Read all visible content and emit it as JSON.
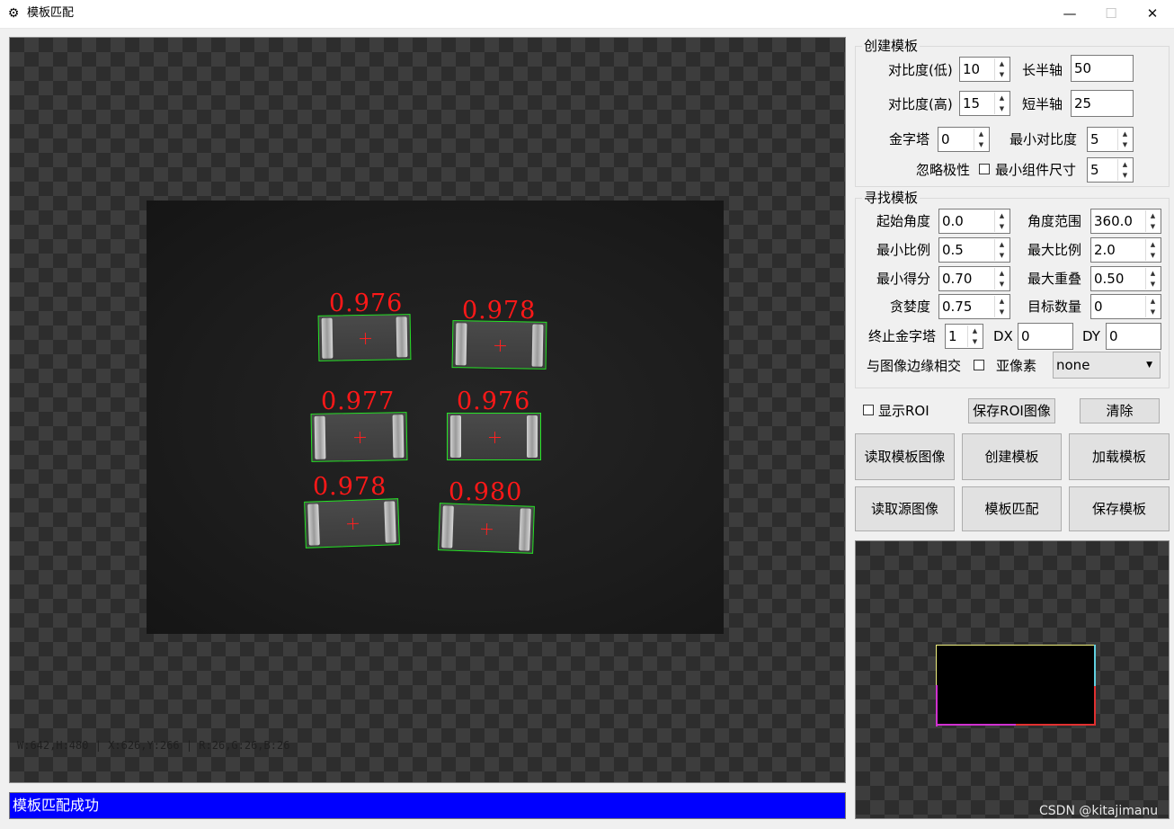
{
  "window": {
    "title": "模板匹配",
    "icon": "gear-icon",
    "minimize": "—",
    "maximize": "☐",
    "close": "✕"
  },
  "main_view": {
    "pixel_info": "W:642,H:480 | X:626,Y:266 | R:26,G:26,B:26",
    "scores": [
      "0.976",
      "0.978",
      "0.977",
      "0.976",
      "0.978",
      "0.980"
    ]
  },
  "status": "模板匹配成功",
  "create_template": {
    "title": "创建模板",
    "contrast_low_label": "对比度(低)",
    "contrast_low": "10",
    "contrast_high_label": "对比度(高)",
    "contrast_high": "15",
    "major_axis_label": "长半轴",
    "major_axis": "50",
    "minor_axis_label": "短半轴",
    "minor_axis": "25",
    "pyramid_label": "金字塔",
    "pyramid": "0",
    "min_contrast_label": "最小对比度",
    "min_contrast": "5",
    "ignore_polarity_label": "忽略极性",
    "min_component_label": "最小组件尺寸",
    "min_component": "5"
  },
  "find_template": {
    "title": "寻找模板",
    "start_angle_label": "起始角度",
    "start_angle": "0.0",
    "angle_range_label": "角度范围",
    "angle_range": "360.0",
    "min_scale_label": "最小比例",
    "min_scale": "0.5",
    "max_scale_label": "最大比例",
    "max_scale": "2.0",
    "min_score_label": "最小得分",
    "min_score": "0.70",
    "max_overlap_label": "最大重叠",
    "max_overlap": "0.50",
    "greediness_label": "贪婪度",
    "greediness": "0.75",
    "num_targets_label": "目标数量",
    "num_targets": "0",
    "stop_pyramid_label": "终止金字塔",
    "stop_pyramid": "1",
    "dx_label": "DX",
    "dx": "0",
    "dy_label": "DY",
    "dy": "0",
    "border_intersect_label": "与图像边缘相交",
    "subpixel_label": "亚像素",
    "subpixel": "none"
  },
  "roi_row": {
    "show_roi_label": "显示ROI",
    "save_roi_button": "保存ROI图像",
    "clear_button": "清除"
  },
  "actions": {
    "read_template_image": "读取模板图像",
    "create_template": "创建模板",
    "load_template": "加载模板",
    "read_source_image": "读取源图像",
    "match_template": "模板匹配",
    "save_template": "保存模板"
  },
  "watermark": "CSDN @kitajimanu"
}
